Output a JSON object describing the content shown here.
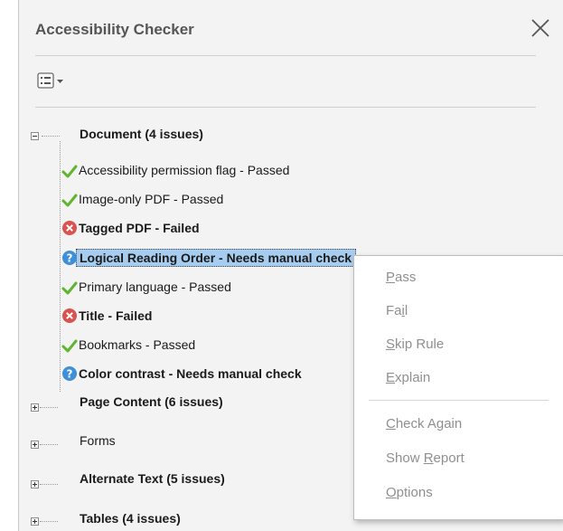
{
  "panel": {
    "title": "Accessibility Checker"
  },
  "tree": {
    "document": {
      "label": "Document (4 issues)",
      "items": [
        {
          "label": "Accessibility permission flag - Passed",
          "status": "passed"
        },
        {
          "label": "Image-only PDF - Passed",
          "status": "passed"
        },
        {
          "label": "Tagged PDF - Failed",
          "status": "failed"
        },
        {
          "label": "Logical Reading Order - Needs manual check",
          "status": "needs-check"
        },
        {
          "label": "Primary language - Passed",
          "status": "passed"
        },
        {
          "label": "Title - Failed",
          "status": "failed"
        },
        {
          "label": "Bookmarks - Passed",
          "status": "passed"
        },
        {
          "label": "Color contrast - Needs manual check",
          "status": "needs-check"
        }
      ]
    },
    "categories": [
      {
        "label": "Page Content (6 issues)"
      },
      {
        "label": "Forms"
      },
      {
        "label": "Alternate Text (5 issues)"
      },
      {
        "label": "Tables (4 issues)"
      }
    ]
  },
  "context_menu": {
    "items": [
      {
        "pre": "",
        "u": "P",
        "post": "ass"
      },
      {
        "pre": "Fa",
        "u": "i",
        "post": "l"
      },
      {
        "pre": "",
        "u": "S",
        "post": "kip Rule"
      },
      {
        "pre": "",
        "u": "E",
        "post": "xplain"
      },
      {
        "pre": "",
        "u": "C",
        "post": "heck Again"
      },
      {
        "pre": "Show ",
        "u": "R",
        "post": "eport"
      },
      {
        "pre": "",
        "u": "O",
        "post": "ptions"
      }
    ]
  },
  "colors": {
    "passed": "#5fb52e",
    "failed": "#d9534f",
    "needs_check": "#3d8fd8",
    "selection": "#a6cdf0"
  },
  "icons": {
    "close": "close-icon",
    "options": "options-list-icon",
    "passed": "checkmark-icon",
    "failed": "error-x-icon",
    "needs_check": "question-icon"
  }
}
